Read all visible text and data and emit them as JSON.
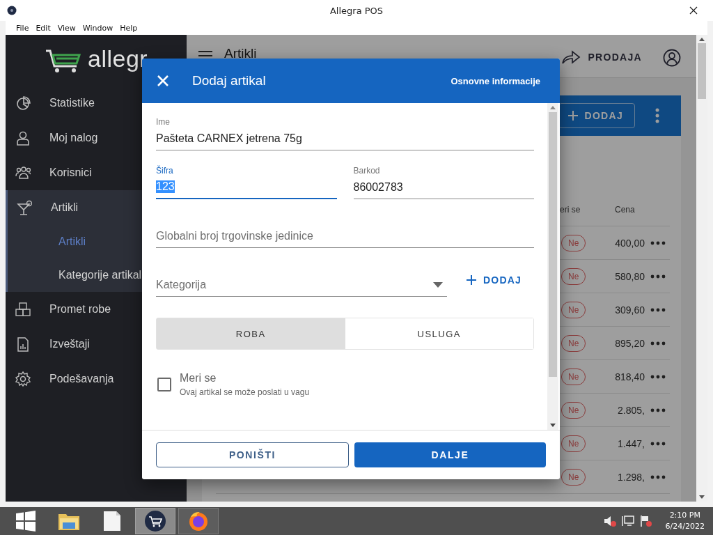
{
  "window": {
    "title": "Allegra POS"
  },
  "menu": [
    "File",
    "Edit",
    "View",
    "Window",
    "Help"
  ],
  "sidebar": {
    "logo": "allegr",
    "items": [
      {
        "kind": "chart",
        "label": "Statistike",
        "expanded": false
      },
      {
        "kind": "person",
        "label": "Moj nalog",
        "expanded": false
      },
      {
        "kind": "people",
        "label": "Korisnici",
        "expanded": false
      },
      {
        "kind": "glass",
        "label": "Artikli",
        "expanded": true,
        "children": [
          {
            "label": "Artikli",
            "selected": true
          },
          {
            "label": "Kategorije artikal",
            "selected": false
          }
        ]
      },
      {
        "kind": "boxes",
        "label": "Promet robe",
        "expanded": false
      },
      {
        "kind": "report",
        "label": "Izveštaji",
        "expanded": false
      },
      {
        "kind": "gear",
        "label": "Podešavanja",
        "expanded": false
      }
    ]
  },
  "header": {
    "title": "Artikli",
    "action": "PRODAJA"
  },
  "card": {
    "add_button": "DODAJ"
  },
  "table": {
    "columns": [
      "eri se",
      "Cena"
    ],
    "rows": [
      {
        "meri_se": "Ne",
        "cena": "400,00"
      },
      {
        "meri_se": "Ne",
        "cena": "580,80"
      },
      {
        "meri_se": "Ne",
        "cena": "309,60"
      },
      {
        "meri_se": "Ne",
        "cena": "895,20"
      },
      {
        "meri_se": "Ne",
        "cena": "818,40"
      },
      {
        "meri_se": "Ne",
        "cena": "2.805,"
      },
      {
        "meri_se": "Ne",
        "cena": "1.447,"
      },
      {
        "meri_se": "Ne",
        "cena": "1.298,"
      }
    ]
  },
  "dialog": {
    "title": "Dodaj artikal",
    "step": "Osnovne informacije",
    "field_rows": [
      [
        {
          "kind": "text",
          "label": "Ime",
          "value": "Pašteta CARNEX jetrena 75g",
          "focused": false
        }
      ],
      [
        {
          "kind": "text",
          "label": "Šifra",
          "value": "123",
          "focused": true
        },
        {
          "kind": "text",
          "label": "Barkod",
          "value": "86002783",
          "focused": false
        }
      ],
      [
        {
          "kind": "text",
          "placeholder": "Globalni broj trgovinske jedinice",
          "focused": false
        }
      ],
      [
        {
          "kind": "select",
          "placeholder": "Kategorija",
          "focused": false,
          "add_button": "DODAJ"
        }
      ]
    ],
    "type_toggle": [
      {
        "label": "ROBA",
        "selected": true
      },
      {
        "label": "USLUGA",
        "selected": false
      }
    ],
    "checkbox": {
      "label": "Meri se",
      "hint": "Ovaj artikal se može poslati u vagu",
      "checked": false
    },
    "buttons": [
      {
        "label": "PONIŠTI",
        "kind": "outlined"
      },
      {
        "label": "DALJE",
        "kind": "filled"
      }
    ]
  },
  "taskbar": {
    "apps": [
      {
        "kind": "start",
        "active": false,
        "running": false
      },
      {
        "kind": "folder",
        "active": false,
        "running": false
      },
      {
        "kind": "file",
        "active": false,
        "running": false
      },
      {
        "kind": "cart",
        "active": true,
        "running": true
      },
      {
        "kind": "firefox",
        "active": false,
        "running": true
      }
    ],
    "time": "2:10 PM",
    "date": "6/24/2022"
  }
}
